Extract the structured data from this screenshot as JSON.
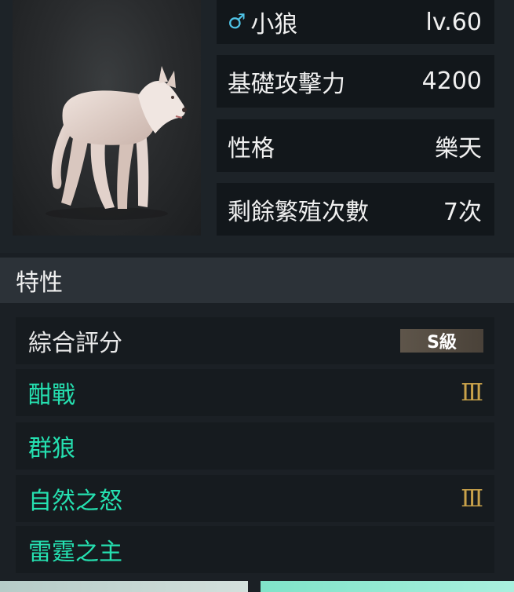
{
  "pet": {
    "gender_symbol": "♂",
    "name": "小狼",
    "level": "lv.60"
  },
  "stats": [
    {
      "label": "基礎攻擊力",
      "value": "4200"
    },
    {
      "label": "性格",
      "value": "樂天"
    },
    {
      "label": "剩餘繁殖次數",
      "value": "7次"
    }
  ],
  "traits_section": {
    "title": "特性",
    "overall": {
      "label": "綜合評分",
      "grade": "S級"
    },
    "items": [
      {
        "name": "酣戰",
        "level": "Ⅲ"
      },
      {
        "name": "群狼",
        "level": ""
      },
      {
        "name": "自然之怒",
        "level": "Ⅲ"
      },
      {
        "name": "雷霆之主",
        "level": ""
      }
    ]
  },
  "colors": {
    "trait_green": "#25e0b0",
    "gender_blue": "#4fc3e6",
    "roman_gold": "#c9a24a"
  }
}
